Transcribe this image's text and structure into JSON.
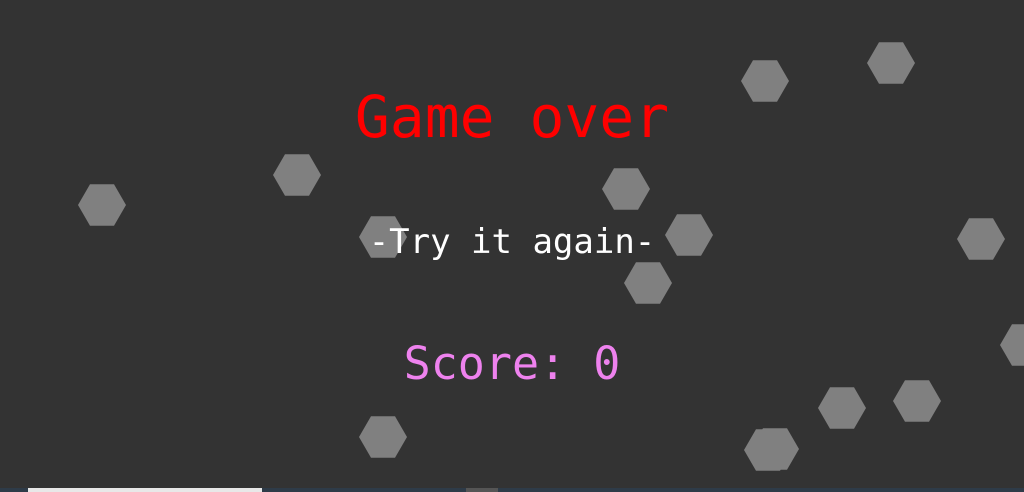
{
  "game": {
    "title": "Game over",
    "restart_label": "-Try it again-",
    "score_label": "Score:",
    "score": 0
  },
  "colors": {
    "background": "#333333",
    "obstacle": "#808080",
    "game_over": "#ff0000",
    "restart": "#ffffff",
    "score": "#ee82ee"
  },
  "obstacles": {
    "shape": "hexagon-icon"
  }
}
